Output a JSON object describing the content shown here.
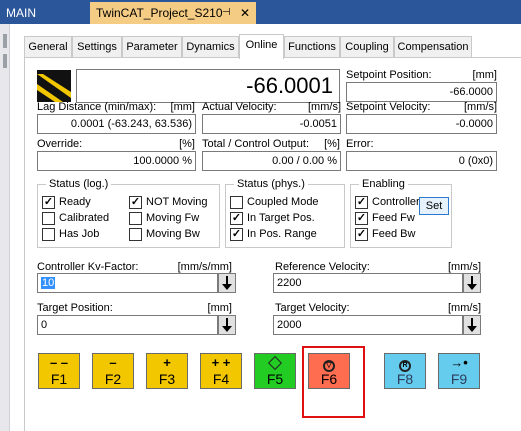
{
  "doc_tabs": {
    "main_label": "MAIN",
    "project_label": "TwinCAT_Project_S210",
    "pin_glyph": "⊣",
    "close_glyph": "✕"
  },
  "tabs": [
    "General",
    "Settings",
    "Parameter",
    "Dynamics",
    "Online",
    "Functions",
    "Coupling",
    "Compensation"
  ],
  "active_tab": "Online",
  "online": {
    "position_display": "-66.0001",
    "setpoint_position": {
      "label": "Setpoint Position:",
      "unit": "[mm]",
      "value": "-66.0000"
    },
    "lag_distance": {
      "label": "Lag Distance (min/max):",
      "unit": "[mm]",
      "value": "0.0001  (-63.243, 63.536)"
    },
    "actual_velocity": {
      "label": "Actual Velocity:",
      "unit": "[mm/s]",
      "value": "-0.0051"
    },
    "setpoint_velocity": {
      "label": "Setpoint Velocity:",
      "unit": "[mm/s]",
      "value": "-0.0000"
    },
    "override": {
      "label": "Override:",
      "unit": "[%]",
      "value": "100.0000 %"
    },
    "total_control_output": {
      "label": "Total / Control Output:",
      "unit": "[%]",
      "value": "0.00 /  0.00 %"
    },
    "error": {
      "label": "Error:",
      "value": "0 (0x0)"
    }
  },
  "status_log": {
    "title": "Status (log.)",
    "items": [
      {
        "label": "Ready",
        "checked": true
      },
      {
        "label": "NOT Moving",
        "checked": true
      },
      {
        "label": "Calibrated",
        "checked": false
      },
      {
        "label": "Moving Fw",
        "checked": false
      },
      {
        "label": "Has Job",
        "checked": false
      },
      {
        "label": "Moving Bw",
        "checked": false
      }
    ]
  },
  "status_phys": {
    "title": "Status (phys.)",
    "items": [
      {
        "label": "Coupled Mode",
        "checked": false
      },
      {
        "label": "In Target Pos.",
        "checked": true
      },
      {
        "label": "In Pos. Range",
        "checked": true
      }
    ]
  },
  "enabling": {
    "title": "Enabling",
    "items": [
      {
        "label": "Controller",
        "checked": true
      },
      {
        "label": "Feed Fw",
        "checked": true
      },
      {
        "label": "Feed Bw",
        "checked": true
      }
    ],
    "set_label": "Set"
  },
  "kv_factor": {
    "label": "Controller Kv-Factor:",
    "unit": "[mm/s/mm]",
    "value": "10"
  },
  "reference_velocity": {
    "label": "Reference Velocity:",
    "unit": "[mm/s]",
    "value": "2200"
  },
  "target_position": {
    "label": "Target Position:",
    "unit": "[mm]",
    "value": "0"
  },
  "target_velocity": {
    "label": "Target Velocity:",
    "unit": "[mm/s]",
    "value": "2000"
  },
  "function_buttons": [
    {
      "key": "F1",
      "symbol": "– –",
      "color": "#f2c700"
    },
    {
      "key": "F2",
      "symbol": "–",
      "color": "#f2c700"
    },
    {
      "key": "F3",
      "symbol": "+",
      "color": "#f2c700"
    },
    {
      "key": "F4",
      "symbol": "+ +",
      "color": "#f2c700"
    },
    {
      "key": "F5",
      "symbol": "diamond",
      "color": "#22cc22"
    },
    {
      "key": "F6",
      "symbol": "stop-circle",
      "color": "#ff6d50"
    },
    {
      "key": "F8",
      "symbol": "R-circle",
      "color": "#66ccee"
    },
    {
      "key": "F9",
      "symbol": "→•",
      "color": "#66ccee"
    }
  ],
  "icons": {
    "axis_logo": "yellow-black-stripe-icon",
    "arrow": "down-arrow-icon"
  }
}
